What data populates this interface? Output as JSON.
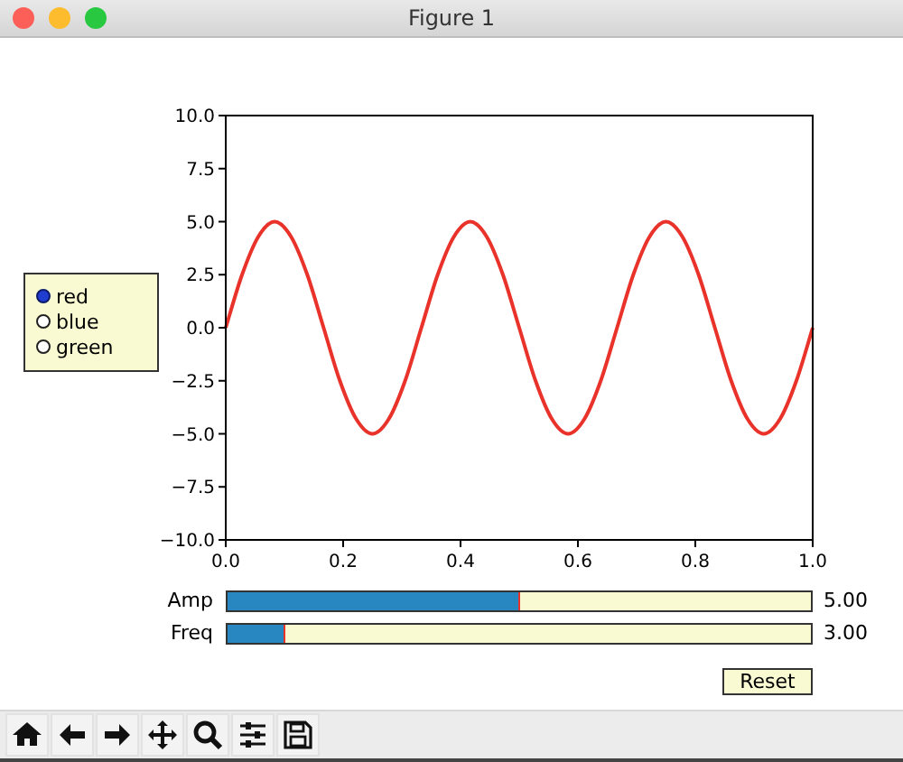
{
  "window": {
    "title": "Figure 1"
  },
  "radio_buttons": [
    {
      "label": "red",
      "selected": true
    },
    {
      "label": "blue",
      "selected": false
    },
    {
      "label": "green",
      "selected": false
    }
  ],
  "chart": {
    "chart_data": {
      "type": "line",
      "xlim": [
        0,
        1
      ],
      "ylim": [
        -10,
        10
      ],
      "xticks": [
        {
          "value": 0,
          "label": "0.0"
        },
        {
          "value": 0.2,
          "label": "0.2"
        },
        {
          "value": 0.4,
          "label": "0.4"
        },
        {
          "value": 0.6,
          "label": "0.6"
        },
        {
          "value": 0.8,
          "label": "0.8"
        },
        {
          "value": 1,
          "label": "1.0"
        }
      ],
      "yticks": [
        {
          "value": -10,
          "label": "−10.0"
        },
        {
          "value": -7.5,
          "label": "−7.5"
        },
        {
          "value": -5,
          "label": "−5.0"
        },
        {
          "value": -2.5,
          "label": "−2.5"
        },
        {
          "value": 0,
          "label": "0.0"
        },
        {
          "value": 2.5,
          "label": "2.5"
        },
        {
          "value": 5,
          "label": "5.0"
        },
        {
          "value": 7.5,
          "label": "7.5"
        },
        {
          "value": 10,
          "label": "10.0"
        }
      ],
      "x": [
        0,
        0.0278,
        0.0556,
        0.0833,
        0.1111,
        0.1389,
        0.1667,
        0.1944,
        0.2222,
        0.25,
        0.2778,
        0.3056,
        0.3333,
        0.3611,
        0.3889,
        0.4167,
        0.4444,
        0.4722,
        0.5,
        0.5278,
        0.5556,
        0.5833,
        0.6111,
        0.6389,
        0.6667,
        0.6944,
        0.7222,
        0.75,
        0.7778,
        0.8056,
        0.8333,
        0.8611,
        0.8889,
        0.9167,
        0.9444,
        0.9722,
        1
      ],
      "series": [
        {
          "color": "#e8322a",
          "values": [
            0,
            2.5,
            4.3,
            5,
            4.3,
            2.5,
            0,
            -2.5,
            -4.3,
            -5,
            -4.3,
            -2.5,
            0,
            2.5,
            4.3,
            5,
            4.3,
            2.5,
            0,
            -2.5,
            -4.3,
            -5,
            -4.3,
            -2.5,
            0,
            2.5,
            4.3,
            5,
            4.3,
            2.5,
            0,
            -2.5,
            -4.3,
            -5,
            -4.3,
            -2.5,
            0
          ]
        }
      ]
    }
  },
  "sliders": [
    {
      "label": "Amp",
      "level": 0.5,
      "reading": "5.00"
    },
    {
      "label": "Freq",
      "level": 0.1,
      "reading": "3.00"
    }
  ],
  "button": {
    "label": "Reset"
  }
}
